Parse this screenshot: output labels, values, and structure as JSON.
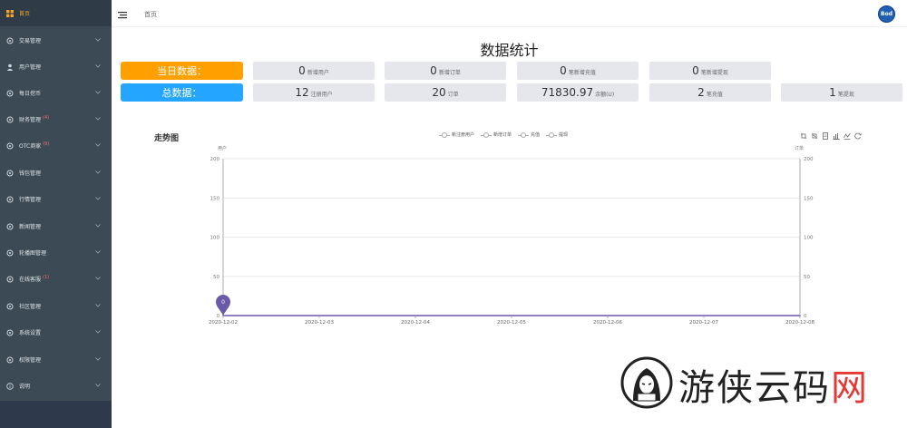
{
  "sidebar": {
    "items": [
      {
        "label": "首页",
        "icon": "grid-icon",
        "badge": ""
      },
      {
        "label": "交易管理",
        "icon": "gear-icon",
        "badge": ""
      },
      {
        "label": "用户管理",
        "icon": "user-icon",
        "badge": ""
      },
      {
        "label": "每日挖币",
        "icon": "gear-icon",
        "badge": ""
      },
      {
        "label": "财务管理",
        "icon": "gear-icon",
        "badge": "(4)"
      },
      {
        "label": "OTC商家",
        "icon": "gear-icon",
        "badge": "(9)"
      },
      {
        "label": "钱包管理",
        "icon": "gear-icon",
        "badge": ""
      },
      {
        "label": "行情管理",
        "icon": "gear-icon",
        "badge": ""
      },
      {
        "label": "新闻管理",
        "icon": "gear-icon",
        "badge": ""
      },
      {
        "label": "轮播图管理",
        "icon": "gear-icon",
        "badge": ""
      },
      {
        "label": "在线客服",
        "icon": "gear-icon",
        "badge": "(1)"
      },
      {
        "label": "社区管理",
        "icon": "gear-icon",
        "badge": ""
      },
      {
        "label": "系统设置",
        "icon": "gear-icon",
        "badge": ""
      },
      {
        "label": "权限管理",
        "icon": "gear-icon",
        "badge": ""
      },
      {
        "label": "说明",
        "icon": "info-icon",
        "badge": ""
      }
    ]
  },
  "header": {
    "breadcrumb": "首页",
    "avatar_text": "Bod"
  },
  "main": {
    "title": "数据统计",
    "today": {
      "label": "当日数据：",
      "stats": [
        {
          "value": "0",
          "unit": "新增用户"
        },
        {
          "value": "0",
          "unit": "新增订单"
        },
        {
          "value": "0",
          "unit": "笔新增充值"
        },
        {
          "value": "0",
          "unit": "笔新增提现"
        }
      ]
    },
    "total": {
      "label": "总数据：",
      "stats": [
        {
          "value": "12",
          "unit": "注册用户"
        },
        {
          "value": "20",
          "unit": "订单"
        },
        {
          "value": "71830.97",
          "unit": "余额(U)"
        },
        {
          "value": "2",
          "unit": "笔充值"
        },
        {
          "value": "1",
          "unit": "笔提现"
        }
      ]
    }
  },
  "chart_data": {
    "type": "line",
    "title": "走势图",
    "x": [
      "2020-12-02",
      "2020-12-03",
      "2020-12-04",
      "2020-12-05",
      "2020-12-06",
      "2020-12-07",
      "2020-12-08"
    ],
    "y_left_label": "用户",
    "y_right_label": "订单",
    "ylim": [
      0,
      200
    ],
    "yticks": [
      0,
      50,
      100,
      150,
      200
    ],
    "series": [
      {
        "name": "新注册用户",
        "values": [
          0,
          0,
          0,
          0,
          0,
          0,
          0
        ]
      },
      {
        "name": "新增订单",
        "values": [
          0,
          0,
          0,
          0,
          0,
          0,
          0
        ]
      },
      {
        "name": "充值",
        "values": [
          0,
          0,
          0,
          0,
          0,
          0,
          0
        ]
      },
      {
        "name": "提现",
        "values": [
          0,
          0,
          0,
          0,
          0,
          0,
          0
        ]
      }
    ],
    "markpoint": {
      "x": "2020-12-02",
      "value": "0"
    },
    "grid": true,
    "legend_position": "top-center",
    "line_color": "#8e7cc3",
    "markpoint_color": "#6a5aa8"
  },
  "toolbox": [
    "zoom-icon",
    "zoom-reset-icon",
    "data-view-icon",
    "bar-chart-icon",
    "line-chart-icon",
    "refresh-icon"
  ],
  "watermark": {
    "text_black": "游侠云码",
    "text_red": "网"
  }
}
